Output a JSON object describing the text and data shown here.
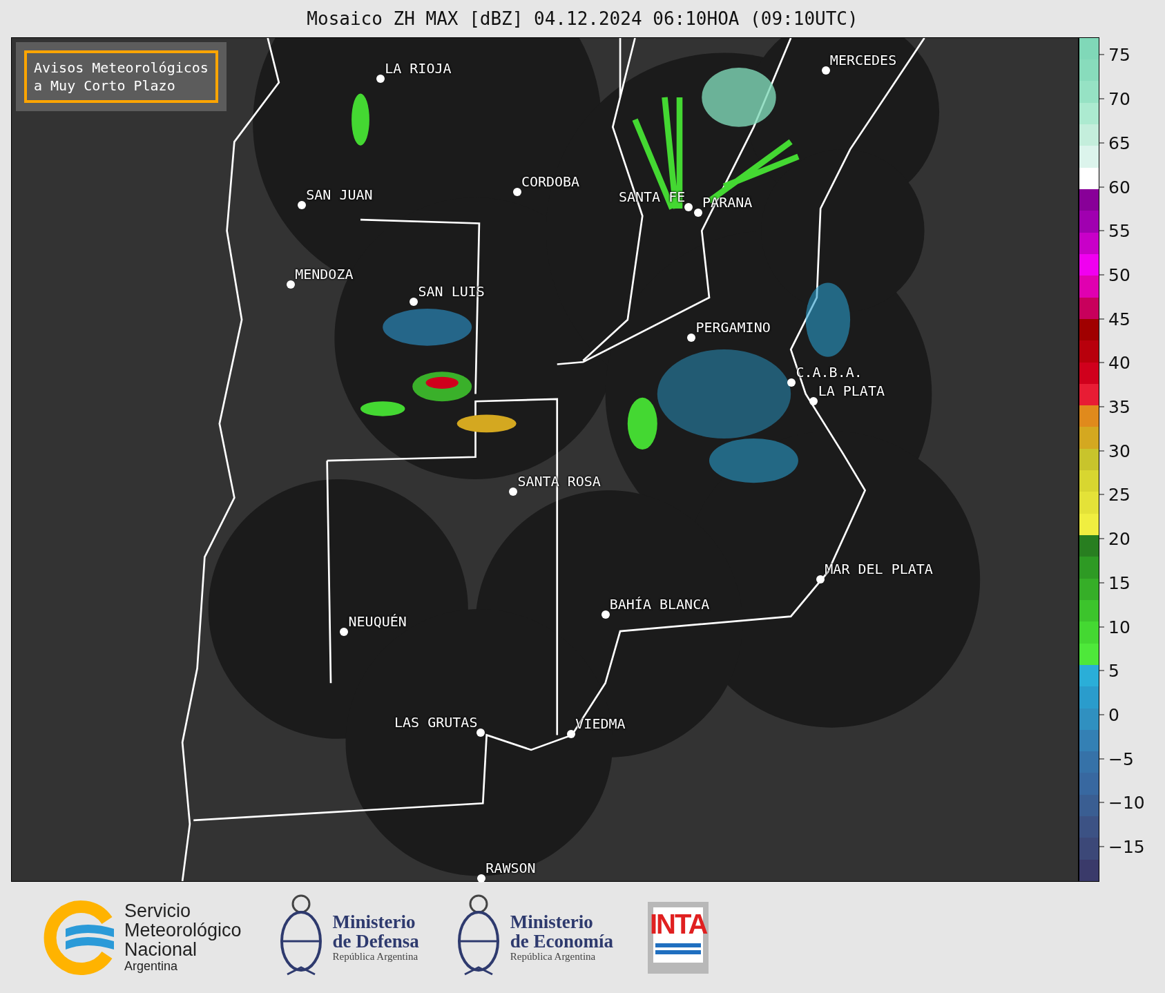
{
  "title": "Mosaico ZH MAX [dBZ] 04.12.2024 06:10HOA (09:10UTC)",
  "notice": [
    "Avisos Meteorológicos",
    "a Muy Corto Plazo"
  ],
  "cities": [
    {
      "name": "LA RIOJA"
    },
    {
      "name": "CORDOBA"
    },
    {
      "name": "SAN JUAN"
    },
    {
      "name": "SANTA FE"
    },
    {
      "name": "PARANA"
    },
    {
      "name": "MERCEDES"
    },
    {
      "name": "MENDOZA"
    },
    {
      "name": "SAN LUIS"
    },
    {
      "name": "PERGAMINO"
    },
    {
      "name": "C.A.B.A."
    },
    {
      "name": "LA PLATA"
    },
    {
      "name": "SANTA ROSA"
    },
    {
      "name": "MAR DEL PLATA"
    },
    {
      "name": "BAHÍA BLANCA"
    },
    {
      "name": "NEUQUÉN"
    },
    {
      "name": "LAS GRUTAS"
    },
    {
      "name": "VIEDMA"
    },
    {
      "name": "RAWSON"
    }
  ],
  "colorbar_ticks": [
    "75",
    "70",
    "65",
    "60",
    "55",
    "50",
    "45",
    "40",
    "35",
    "30",
    "25",
    "20",
    "15",
    "10",
    "5",
    "0",
    "−5",
    "−10",
    "−15"
  ],
  "logos": [
    {
      "kind": "smn",
      "lines": [
        "Servicio",
        "Meteorológico",
        "Nacional"
      ],
      "sub": "Argentina"
    },
    {
      "kind": "ministry",
      "lines": [
        "Ministerio",
        "de Defensa"
      ],
      "sub": "República Argentina"
    },
    {
      "kind": "ministry",
      "lines": [
        "Ministerio",
        "de Economía"
      ],
      "sub": "República Argentina"
    },
    {
      "kind": "inta",
      "lines": [
        "INTA"
      ]
    }
  ]
}
